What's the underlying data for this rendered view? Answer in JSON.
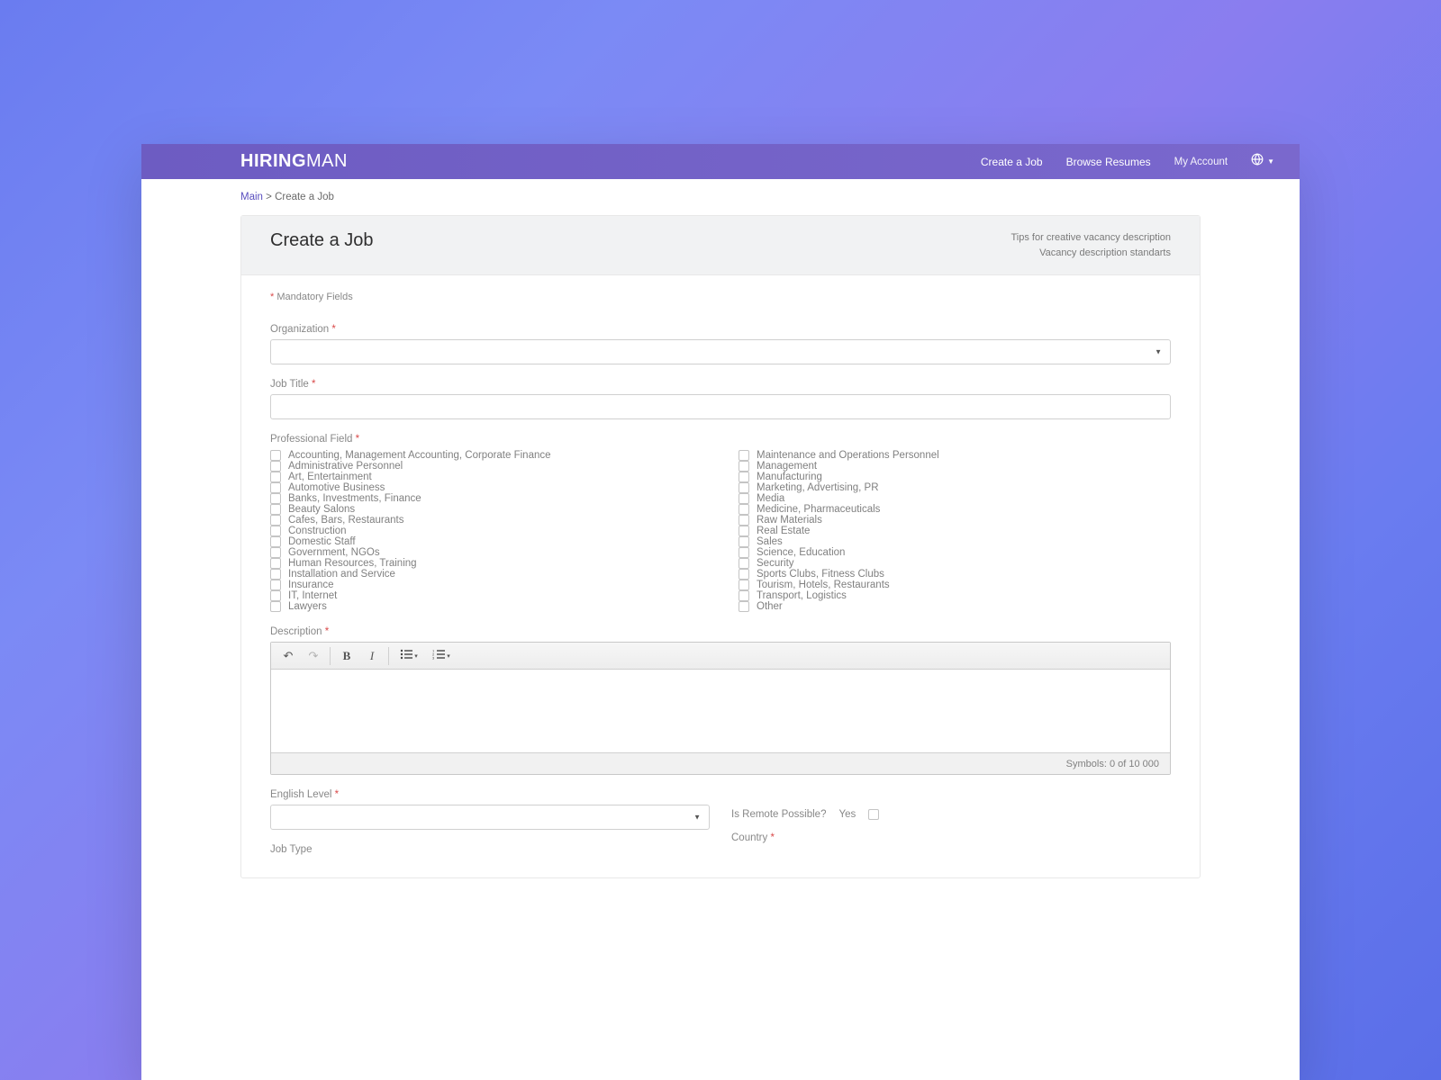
{
  "header": {
    "logo_bold": "HIRING",
    "logo_light": "MAN",
    "nav": {
      "create": "Create a Job",
      "browse": "Browse Resumes",
      "account": "My Account"
    }
  },
  "breadcrumb": {
    "main": "Main",
    "sep": ">",
    "current": "Create a Job"
  },
  "page": {
    "title": "Create a Job",
    "tip1": "Tips for creative vacancy description",
    "tip2": "Vacancy description standarts",
    "mandatory_prefix": "*",
    "mandatory_text": " Mandatory Fields"
  },
  "labels": {
    "organization": "Organization",
    "job_title": "Job Title",
    "professional_field": "Professional Field",
    "description": "Description",
    "english_level": "English Level",
    "job_type": "Job Type",
    "remote": "Is Remote Possible?",
    "remote_yes": "Yes",
    "country": "Country"
  },
  "fields_left": [
    "Accounting, Management Accounting, Corporate Finance",
    "Administrative Personnel",
    "Art, Entertainment",
    "Automotive Business",
    "Banks, Investments, Finance",
    "Beauty Salons",
    "Cafes, Bars, Restaurants",
    "Construction",
    "Domestic Staff",
    "Government, NGOs",
    "Human Resources, Training",
    "Installation and Service",
    "Insurance",
    "IT, Internet",
    "Lawyers"
  ],
  "fields_right": [
    "Maintenance and Operations Personnel",
    "Management",
    "Manufacturing",
    "Marketing, Advertising, PR",
    "Media",
    "Medicine, Pharmaceuticals",
    "Raw Materials",
    "Real Estate",
    "Sales",
    "Science, Education",
    "Security",
    "Sports Clubs, Fitness Clubs",
    "Tourism, Hotels, Restaurants",
    "Transport, Logistics",
    "Other"
  ],
  "editor": {
    "footer": "Symbols: 0 of 10 000"
  }
}
